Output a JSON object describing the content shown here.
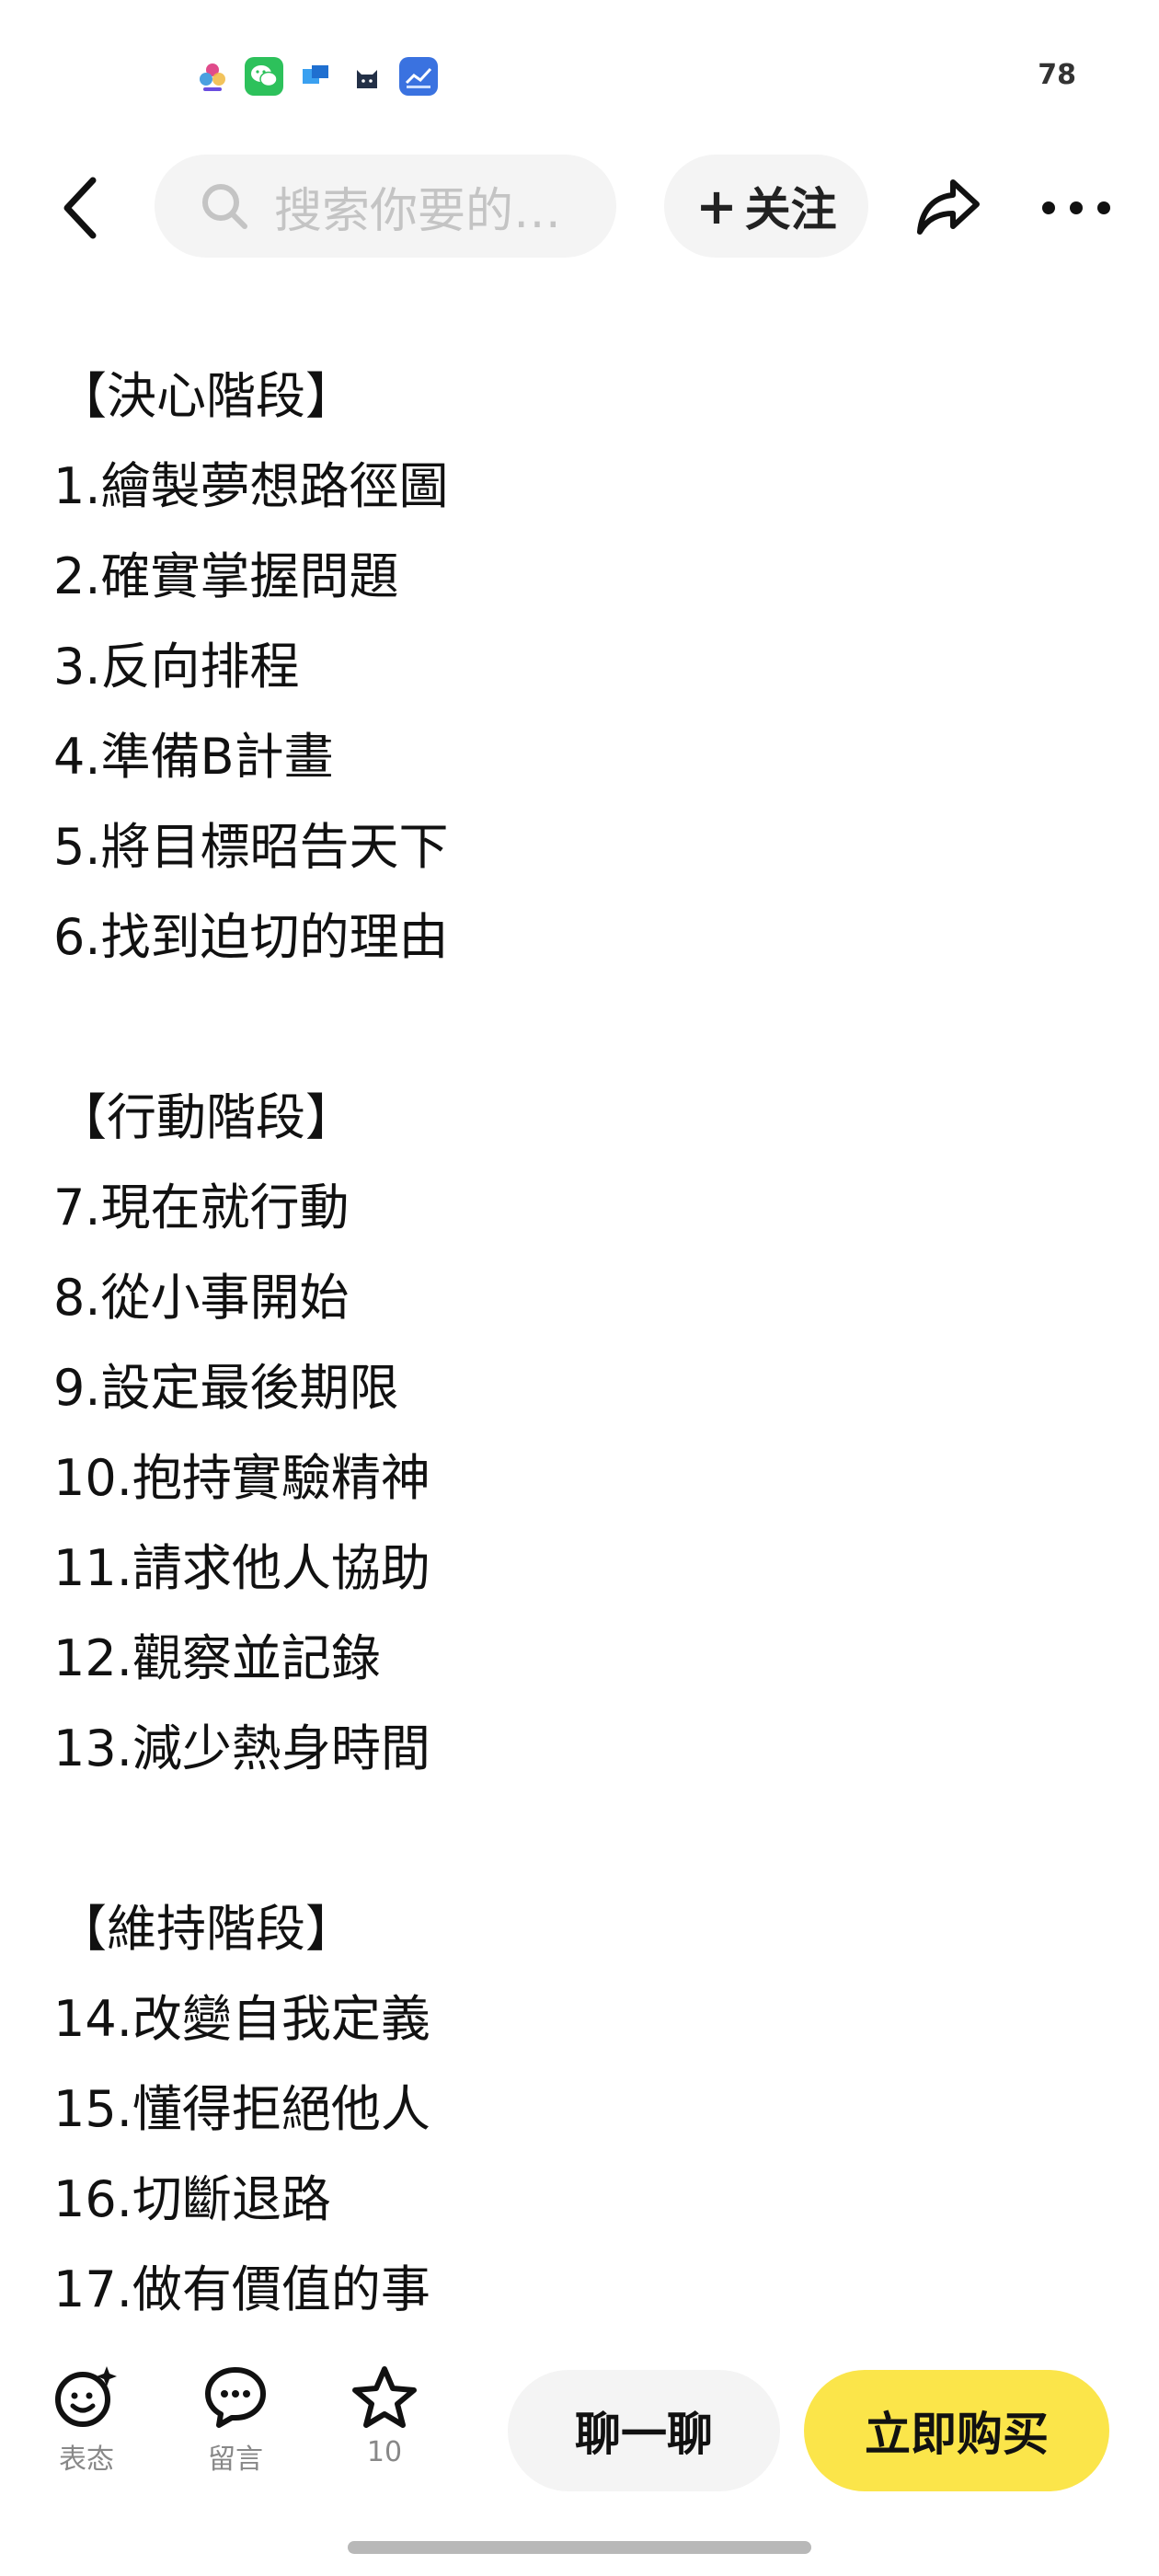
{
  "status_bar": {
    "battery": "78",
    "app_icons": [
      "multi-circle-app-icon",
      "wechat-icon",
      "blue-square-app-icon",
      "cat-app-icon",
      "chart-app-icon"
    ]
  },
  "nav": {
    "search_placeholder": "搜索你要的…",
    "follow_label": "关注"
  },
  "content": {
    "lines": [
      {
        "type": "heading",
        "text": "【決心階段】"
      },
      {
        "type": "item",
        "text": "1.繪製夢想路徑圖"
      },
      {
        "type": "item",
        "text": "2.確實掌握問題"
      },
      {
        "type": "item",
        "text": "3.反向排程"
      },
      {
        "type": "item",
        "text": "4.準備B計畫"
      },
      {
        "type": "item",
        "text": "5.將目標昭告天下"
      },
      {
        "type": "item",
        "text": "6.找到迫切的理由"
      },
      {
        "type": "blank",
        "text": ""
      },
      {
        "type": "heading",
        "text": "【行動階段】"
      },
      {
        "type": "item",
        "text": "7.現在就行動"
      },
      {
        "type": "item",
        "text": "8.從小事開始"
      },
      {
        "type": "item",
        "text": "9.設定最後期限"
      },
      {
        "type": "item",
        "text": "10.抱持實驗精神"
      },
      {
        "type": "item",
        "text": "11.請求他人協助"
      },
      {
        "type": "item",
        "text": "12.觀察並記錄"
      },
      {
        "type": "item",
        "text": "13.減少熱身時間"
      },
      {
        "type": "blank",
        "text": ""
      },
      {
        "type": "heading",
        "text": "【維持階段】"
      },
      {
        "type": "item",
        "text": "14.改變自我定義"
      },
      {
        "type": "item",
        "text": "15.懂得拒絕他人"
      },
      {
        "type": "item",
        "text": "16.切斷退路"
      },
      {
        "type": "item",
        "text": "17.做有價值的事"
      }
    ]
  },
  "bottom_bar": {
    "reaction_label": "表态",
    "comment_label": "留言",
    "star_count": "10",
    "chat_label": "聊一聊",
    "buy_label": "立即购买"
  },
  "colors": {
    "buy_button": "#fbe54a",
    "pill_background": "#f4f4f4",
    "placeholder_text": "#c4c4c4"
  }
}
